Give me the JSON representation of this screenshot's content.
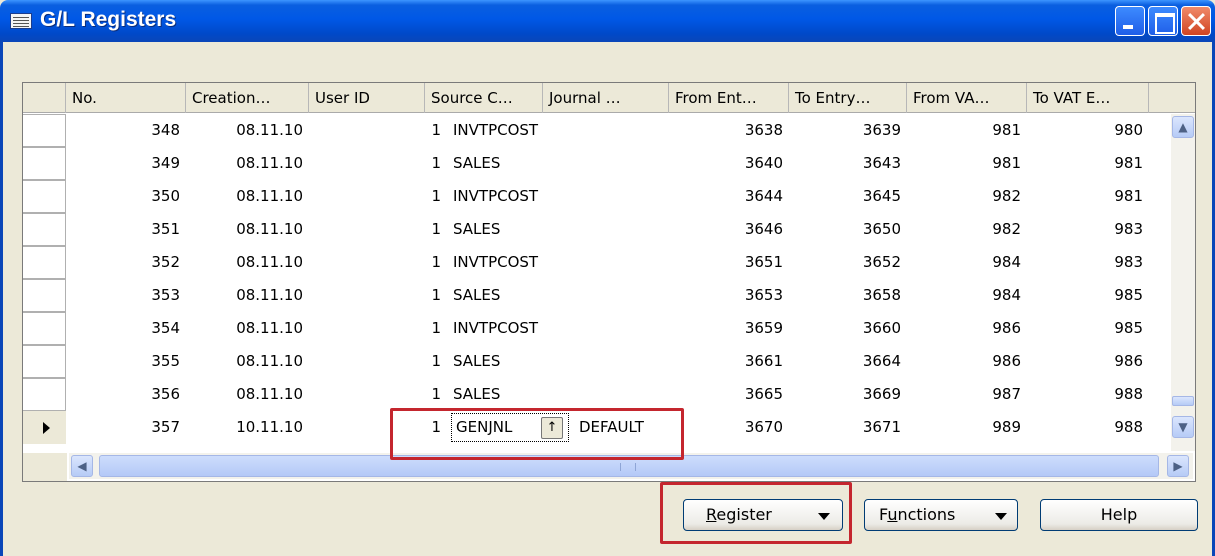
{
  "window": {
    "title": "G/L Registers"
  },
  "columns": [
    "No.",
    "Creation…",
    "User ID",
    "Source C…",
    "Journal …",
    "From Ent…",
    "To Entry…",
    "From VA…",
    "To VAT E…"
  ],
  "rows": [
    {
      "no": "348",
      "date": "08.11.10",
      "user": "1",
      "source": "INVTPCOST",
      "journal": "",
      "from_entry": "3638",
      "to_entry": "3639",
      "from_vat": "981",
      "to_vat": "980"
    },
    {
      "no": "349",
      "date": "08.11.10",
      "user": "1",
      "source": "SALES",
      "journal": "",
      "from_entry": "3640",
      "to_entry": "3643",
      "from_vat": "981",
      "to_vat": "981"
    },
    {
      "no": "350",
      "date": "08.11.10",
      "user": "1",
      "source": "INVTPCOST",
      "journal": "",
      "from_entry": "3644",
      "to_entry": "3645",
      "from_vat": "982",
      "to_vat": "981"
    },
    {
      "no": "351",
      "date": "08.11.10",
      "user": "1",
      "source": "SALES",
      "journal": "",
      "from_entry": "3646",
      "to_entry": "3650",
      "from_vat": "982",
      "to_vat": "983"
    },
    {
      "no": "352",
      "date": "08.11.10",
      "user": "1",
      "source": "INVTPCOST",
      "journal": "",
      "from_entry": "3651",
      "to_entry": "3652",
      "from_vat": "984",
      "to_vat": "983"
    },
    {
      "no": "353",
      "date": "08.11.10",
      "user": "1",
      "source": "SALES",
      "journal": "",
      "from_entry": "3653",
      "to_entry": "3658",
      "from_vat": "984",
      "to_vat": "985"
    },
    {
      "no": "354",
      "date": "08.11.10",
      "user": "1",
      "source": "INVTPCOST",
      "journal": "",
      "from_entry": "3659",
      "to_entry": "3660",
      "from_vat": "986",
      "to_vat": "985"
    },
    {
      "no": "355",
      "date": "08.11.10",
      "user": "1",
      "source": "SALES",
      "journal": "",
      "from_entry": "3661",
      "to_entry": "3664",
      "from_vat": "986",
      "to_vat": "986"
    },
    {
      "no": "356",
      "date": "08.11.10",
      "user": "1",
      "source": "SALES",
      "journal": "",
      "from_entry": "3665",
      "to_entry": "3669",
      "from_vat": "987",
      "to_vat": "988"
    }
  ],
  "current_row": {
    "no": "357",
    "date": "10.11.10",
    "user": "1",
    "source": "GENJNL",
    "journal": "DEFAULT",
    "from_entry": "3670",
    "to_entry": "3671",
    "from_vat": "989",
    "to_vat": "988"
  },
  "buttons": {
    "register": {
      "mnemonic": "R",
      "rest": "egister"
    },
    "functions": {
      "pre": "F",
      "mnemonic": "u",
      "rest": "nctions"
    },
    "help": "Help"
  },
  "highlight_color": "#c4262e"
}
